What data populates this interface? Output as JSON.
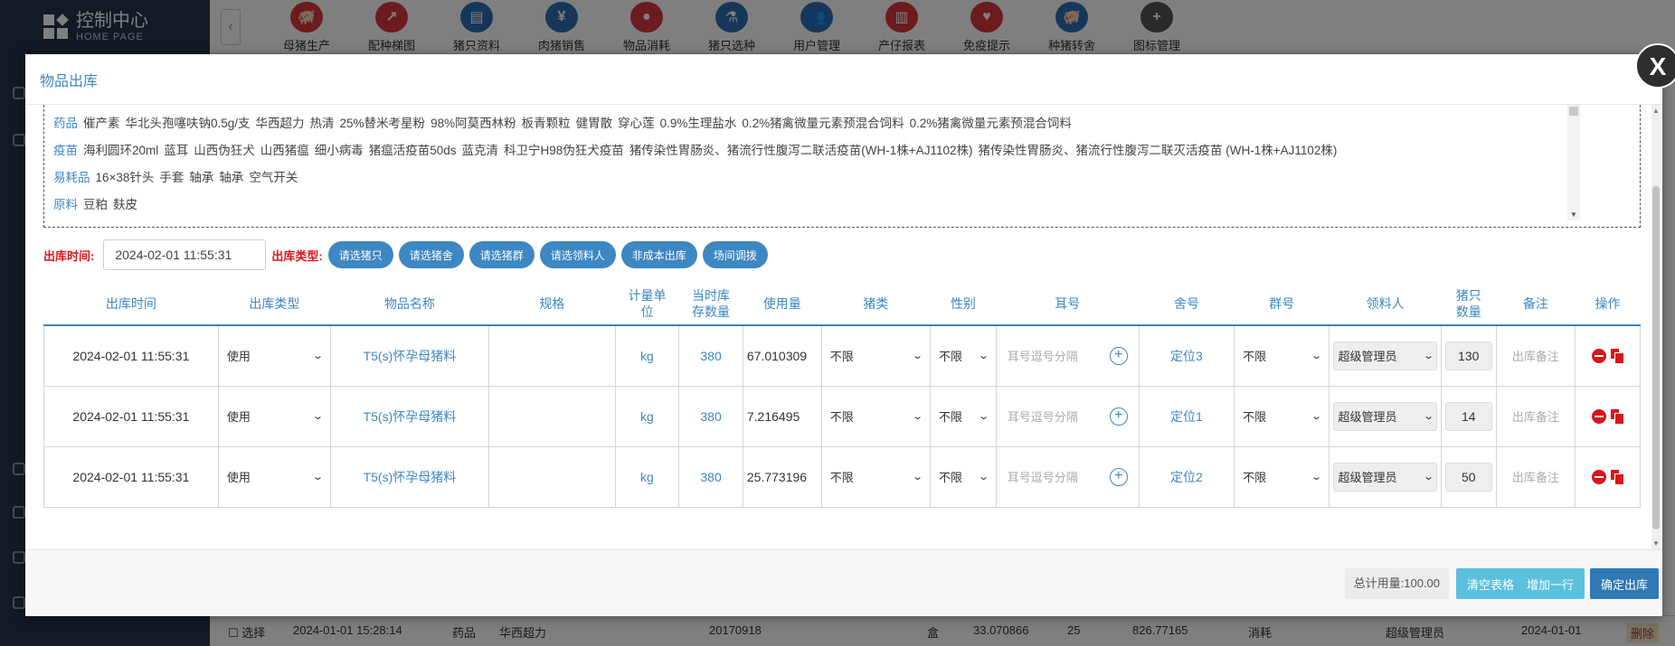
{
  "background": {
    "logo_title": "控制中心",
    "logo_subtitle": "HOME PAGE",
    "nav_items": [
      {
        "label": "母猪生产",
        "icon": "pig-icon",
        "color": "#d9363e"
      },
      {
        "label": "配种梯图",
        "icon": "chart-icon",
        "color": "#d9363e"
      },
      {
        "label": "猪只资料",
        "icon": "book-icon",
        "color": "#2f6fb5"
      },
      {
        "label": "肉猪销售",
        "icon": "money-icon",
        "color": "#2f6fb5"
      },
      {
        "label": "物品消耗",
        "icon": "circles-icon",
        "color": "#d9363e"
      },
      {
        "label": "猪只选种",
        "icon": "flask-icon",
        "color": "#2f6fb5"
      },
      {
        "label": "用户管理",
        "icon": "users-icon",
        "color": "#2f6fb5"
      },
      {
        "label": "产仔报表",
        "icon": "report-icon",
        "color": "#d9363e"
      },
      {
        "label": "免疫提示",
        "icon": "heart-icon",
        "color": "#d9363e"
      },
      {
        "label": "种猪转舍",
        "icon": "pig-icon",
        "color": "#2f6fb5"
      },
      {
        "label": "图标管理",
        "icon": "plus-icon",
        "color": "#555555"
      }
    ],
    "bottom_row": {
      "checkbox_label": "选择",
      "time": "2024-01-01 15:28:14",
      "category": "药品",
      "name": "华西超力",
      "batch": "20170918",
      "unit": "盒",
      "amount": "33.070866",
      "count": "25",
      "total": "826.77165",
      "type": "消耗",
      "user": "超级管理员",
      "date": "2024-01-01",
      "delete_label": "删除"
    }
  },
  "modal": {
    "title": "物品出库",
    "close_label": "X",
    "categories": [
      {
        "name": "药品",
        "items": [
          "催产素",
          "华北头孢噻呋钠0.5g/支",
          "华西超力",
          "热清",
          "25%替米考星粉",
          "98%阿莫西林粉",
          "板青颗粒",
          "健胃散",
          "穿心莲",
          "0.9%生理盐水",
          "0.2%猪禽微量元素预混合饲料",
          "0.2%猪禽微量元素预混合饲料"
        ]
      },
      {
        "name": "疫苗",
        "items": [
          "海利圆环20ml",
          "蓝耳",
          "山西伪狂犬",
          "山西猪瘟",
          "细小病毒",
          "猪瘟活疫苗50ds",
          "蓝克清",
          "科卫宁H98伪狂犬疫苗",
          "猪传染性胃肠炎、猪流行性腹泻二联活疫苗(WH-1株+AJ1102株)",
          "猪传染性胃肠炎、猪流行性腹泻二联灭活疫苗 (WH-1株+AJ1102株)"
        ]
      },
      {
        "name": "易耗品",
        "items": [
          "16×38针头",
          "手套",
          "轴承",
          "轴承",
          "空气开关"
        ]
      },
      {
        "name": "原料",
        "items": [
          "豆粕",
          "麸皮"
        ]
      }
    ],
    "out_time_label": "出库时间:",
    "out_time_value": "2024-02-01 11:55:31",
    "out_type_label": "出库类型:",
    "buttons": [
      "请选猪只",
      "请选猪舍",
      "请选猪群",
      "请选领料人",
      "非成本出库",
      "场间调拨"
    ],
    "columns": [
      "出库时间",
      "出库类型",
      "物品名称",
      "规格",
      "计量单位",
      "当时库存数量",
      "使用量",
      "猪类",
      "性别",
      "耳号",
      "舍号",
      "群号",
      "领料人",
      "猪只数量",
      "备注",
      "操作"
    ],
    "ear_placeholder": "耳号逗号分隔",
    "remark_placeholder": "出库备注",
    "rows": [
      {
        "time": "2024-02-01 11:55:31",
        "type": "使用",
        "name": "T5(s)怀孕母猪料",
        "spec": "",
        "unit": "kg",
        "stock": "380",
        "usage": "67.010309",
        "pig_type": "不限",
        "sex": "不限",
        "pen": "定位3",
        "group": "不限",
        "receiver": "超级管理员",
        "pig_count": "130"
      },
      {
        "time": "2024-02-01 11:55:31",
        "type": "使用",
        "name": "T5(s)怀孕母猪料",
        "spec": "",
        "unit": "kg",
        "stock": "380",
        "usage": "7.216495",
        "pig_type": "不限",
        "sex": "不限",
        "pen": "定位1",
        "group": "不限",
        "receiver": "超级管理员",
        "pig_count": "14"
      },
      {
        "time": "2024-02-01 11:55:31",
        "type": "使用",
        "name": "T5(s)怀孕母猪料",
        "spec": "",
        "unit": "kg",
        "stock": "380",
        "usage": "25.773196",
        "pig_type": "不限",
        "sex": "不限",
        "pen": "定位2",
        "group": "不限",
        "receiver": "超级管理员",
        "pig_count": "50"
      }
    ],
    "total_label": "总计用量:",
    "total_value": "100.00",
    "clear_label": "清空表格",
    "add_row_label": "增加一行",
    "confirm_label": "确定出库"
  }
}
